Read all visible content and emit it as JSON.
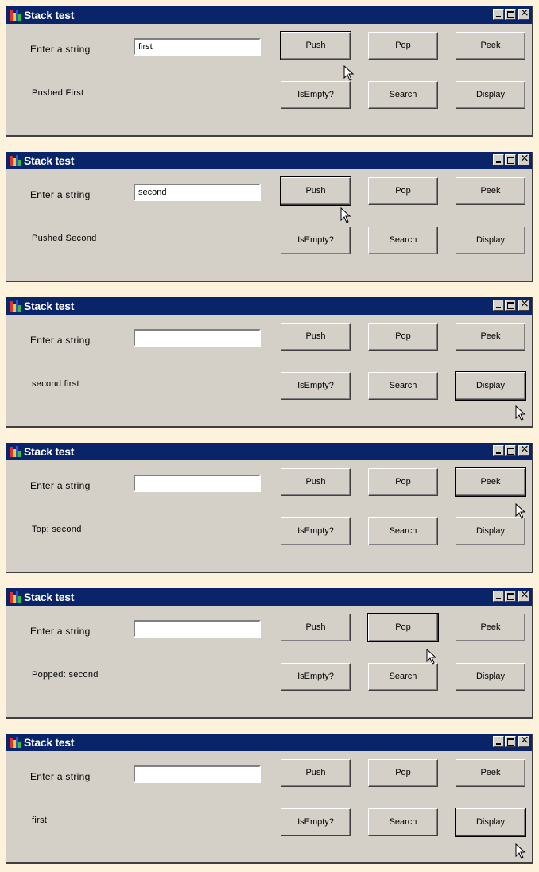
{
  "frames": [
    {
      "title": "Stack test",
      "enter_label": "Enter a string",
      "input_value": "first",
      "status": "Pushed First",
      "push": "Push",
      "pop": "Pop",
      "peek": "Peek",
      "empty": "IsEmpty?",
      "search": "Search",
      "display": "Display"
    },
    {
      "title": "Stack test",
      "enter_label": "Enter a string",
      "input_value": "second",
      "status": "Pushed Second",
      "push": "Push",
      "pop": "Pop",
      "peek": "Peek",
      "empty": "IsEmpty?",
      "search": "Search",
      "display": "Display"
    },
    {
      "title": "Stack test",
      "enter_label": "Enter a string",
      "input_value": "",
      "status": "second first",
      "push": "Push",
      "pop": "Pop",
      "peek": "Peek",
      "empty": "IsEmpty?",
      "search": "Search",
      "display": "Display"
    },
    {
      "title": "Stack test",
      "enter_label": "Enter a string",
      "input_value": "",
      "status": "Top: second",
      "push": "Push",
      "pop": "Pop",
      "peek": "Peek",
      "empty": "IsEmpty?",
      "search": "Search",
      "display": "Display"
    },
    {
      "title": "Stack test",
      "enter_label": "Enter a string",
      "input_value": "",
      "status": "Popped: second",
      "push": "Push",
      "pop": "Pop",
      "peek": "Peek",
      "empty": "IsEmpty?",
      "search": "Search",
      "display": "Display"
    },
    {
      "title": "Stack test",
      "enter_label": "Enter a string",
      "input_value": "",
      "status": "first",
      "push": "Push",
      "pop": "Pop",
      "peek": "Peek",
      "empty": "IsEmpty?",
      "search": "Search",
      "display": "Display"
    }
  ],
  "colors": {
    "titlebar": "#0a246a",
    "window_face": "#d4d0c8",
    "background": "#fdf3dc"
  },
  "icons": {
    "app": "stack-app-icon",
    "minimize": "minimize-icon",
    "maximize": "maximize-icon",
    "close": "close-icon",
    "cursor": "mouse-cursor-icon"
  }
}
